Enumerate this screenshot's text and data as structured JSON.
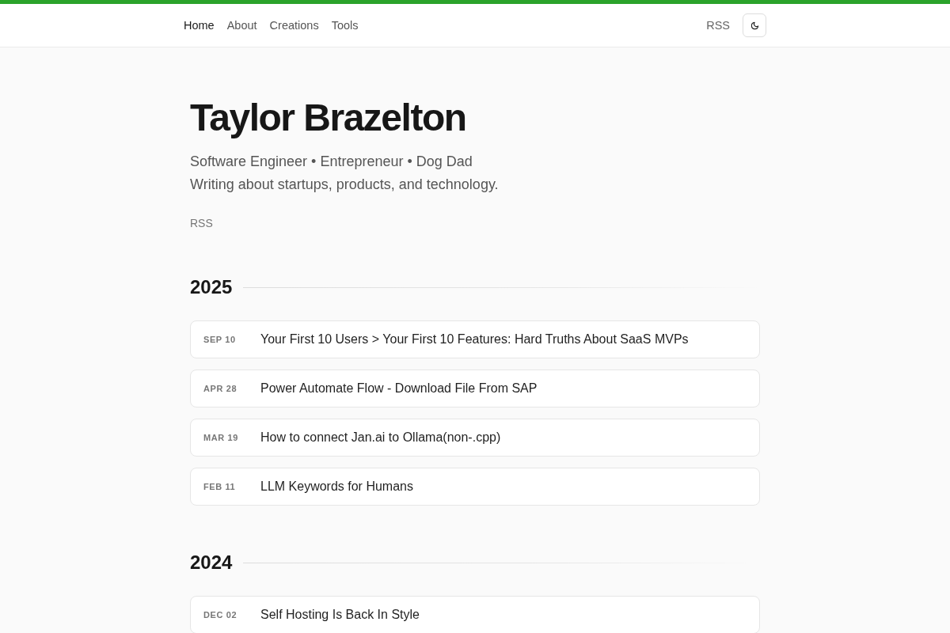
{
  "header": {
    "nav": [
      {
        "label": "Home",
        "selected": true
      },
      {
        "label": "About",
        "selected": false
      },
      {
        "label": "Creations",
        "selected": false
      },
      {
        "label": "Tools",
        "selected": false
      }
    ],
    "rss": "RSS"
  },
  "profile": {
    "name": "Taylor Brazelton",
    "tagline": "Software Engineer • Entrepreneur • Dog Dad",
    "description": "Writing about startups, products, and technology.",
    "rss": "RSS"
  },
  "archive": [
    {
      "year": "2025",
      "posts": [
        {
          "date": "SEP 10",
          "title": "Your First 10 Users > Your First 10 Features: Hard Truths About SaaS MVPs"
        },
        {
          "date": "APR 28",
          "title": "Power Automate Flow - Download File From SAP"
        },
        {
          "date": "MAR 19",
          "title": "How to connect Jan.ai to Ollama(non-.cpp)"
        },
        {
          "date": "FEB 11",
          "title": "LLM Keywords for Humans"
        }
      ]
    },
    {
      "year": "2024",
      "posts": [
        {
          "date": "DEC 02",
          "title": "Self Hosting Is Back In Style"
        }
      ]
    }
  ]
}
